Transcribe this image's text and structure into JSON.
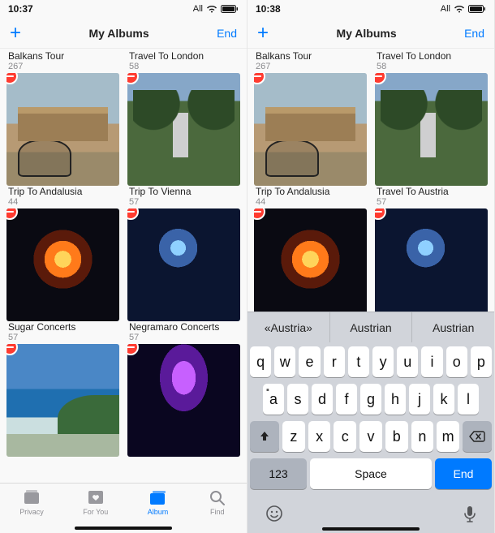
{
  "left": {
    "status": {
      "time": "10:37",
      "carrier": "All"
    },
    "nav": {
      "title": "My Albums",
      "done": "End"
    },
    "albums": [
      {
        "title": "Balkans Tour",
        "count": "267",
        "art": "plaza_prev"
      },
      {
        "title": "Travel To London",
        "count": "58",
        "art": "park_prev"
      },
      {
        "title": "Trip To Andalusia",
        "count": "44",
        "art": "plaza"
      },
      {
        "title": "Trip To Vienna",
        "count": "57",
        "art": "park"
      },
      {
        "title": "Sugar Concerts",
        "count": "57",
        "art": "concert"
      },
      {
        "title": "Negramaro Concerts",
        "count": "57",
        "art": "concert2"
      },
      {
        "title": "",
        "count": "",
        "art": "beach"
      },
      {
        "title": "",
        "count": "",
        "art": "stage"
      }
    ],
    "tabs": [
      {
        "label": "Privacy"
      },
      {
        "label": "For You"
      },
      {
        "label": "Album"
      },
      {
        "label": "Find"
      }
    ]
  },
  "right": {
    "status": {
      "time": "10:38",
      "carrier": "All"
    },
    "nav": {
      "title": "My Albums",
      "done": "End"
    },
    "albums": [
      {
        "title": "Balkans Tour",
        "count": "267"
      },
      {
        "title": "Travel To London",
        "count": "58"
      },
      {
        "title": "Trip To Andalusia",
        "count": "44"
      },
      {
        "title": "Travel To Austria",
        "count": "57"
      }
    ],
    "suggestions": [
      "«Austria»",
      "Austrian",
      "Austrian"
    ],
    "keyboard": {
      "row1": [
        "q",
        "w",
        "e",
        "r",
        "t",
        "y",
        "u",
        "i",
        "o",
        "p"
      ],
      "row2": [
        "a",
        "s",
        "d",
        "f",
        "g",
        "h",
        "j",
        "k",
        "l"
      ],
      "row3": [
        "z",
        "x",
        "c",
        "v",
        "b",
        "n",
        "m"
      ],
      "numKey": "123",
      "space": "Space",
      "return": "End"
    }
  }
}
